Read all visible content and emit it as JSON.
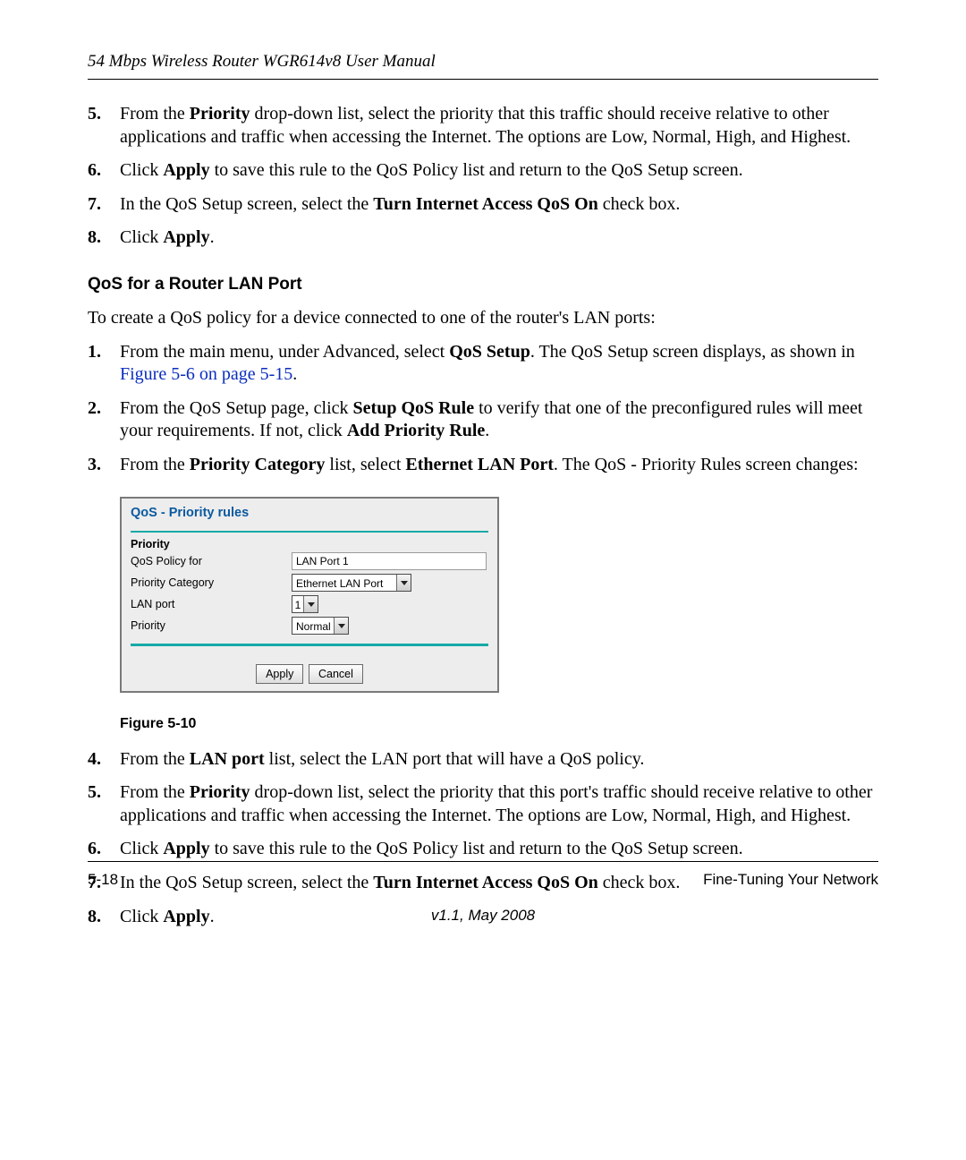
{
  "header": {
    "title": "54 Mbps Wireless Router WGR614v8 User Manual"
  },
  "section_a": {
    "items": [
      {
        "num": "5.",
        "prefix": "From the ",
        "bold1": "Priority",
        "rest": " drop-down list, select the priority that this traffic should receive relative to other applications and traffic when accessing the Internet. The options are Low, Normal, High, and Highest."
      },
      {
        "num": "6.",
        "prefix": "Click ",
        "bold1": "Apply",
        "rest": " to save this rule to the QoS Policy list and return to the QoS Setup screen."
      },
      {
        "num": "7.",
        "prefix": "In the QoS Setup screen, select the ",
        "bold1": "Turn Internet Access QoS On",
        "rest": " check box."
      },
      {
        "num": "8.",
        "prefix": "Click ",
        "bold1": "Apply",
        "rest": "."
      }
    ]
  },
  "heading1": "QoS for a Router LAN Port",
  "intro": "To create a QoS policy for a device connected to one of the router's LAN ports:",
  "section_b": {
    "item1": {
      "num": "1.",
      "t1": "From the main menu, under Advanced, select ",
      "b1": "QoS Setup",
      "t2": ". The QoS Setup screen displays, as shown in ",
      "link": "Figure 5-6 on page 5-15",
      "t3": "."
    },
    "item2": {
      "num": "2.",
      "t1": "From the QoS Setup page, click ",
      "b1": "Setup QoS Rule",
      "t2": " to verify that one of the preconfigured rules will meet your requirements. If not, click ",
      "b2": "Add Priority Rule",
      "t3": "."
    },
    "item3": {
      "num": "3.",
      "t1": "From the ",
      "b1": "Priority Category",
      "t2": " list, select ",
      "b2": "Ethernet LAN Port",
      "t3": ". The QoS - Priority Rules screen changes:"
    }
  },
  "figure": {
    "panel_title": "QoS - Priority rules",
    "subtitle": "Priority",
    "rows": {
      "policy_label": "QoS Policy for",
      "policy_value": "LAN Port 1",
      "category_label": "Priority Category",
      "category_value": "Ethernet LAN Port",
      "lanport_label": "LAN port",
      "lanport_value": "1",
      "priority_label": "Priority",
      "priority_value": "Normal"
    },
    "buttons": {
      "apply": "Apply",
      "cancel": "Cancel"
    },
    "caption": "Figure 5-10"
  },
  "section_c": {
    "item4": {
      "num": "4.",
      "t1": "From the ",
      "b1": "LAN port",
      "t2": " list, select the LAN port that will have a QoS policy."
    },
    "item5": {
      "num": "5.",
      "t1": "From the ",
      "b1": "Priority",
      "t2": " drop-down list, select the priority that this port's traffic should receive relative to other applications and traffic when accessing the Internet. The options are Low, Normal, High, and Highest."
    },
    "item6": {
      "num": "6.",
      "t1": "Click ",
      "b1": "Apply",
      "t2": " to save this rule to the QoS Policy list and return to the QoS Setup screen."
    },
    "item7": {
      "num": "7.",
      "t1": "In the QoS Setup screen, select the ",
      "b1": "Turn Internet Access QoS On",
      "t2": " check box."
    },
    "item8": {
      "num": "8.",
      "t1": "Click ",
      "b1": "Apply",
      "t2": "."
    }
  },
  "footer": {
    "left": "5-18",
    "right": "Fine-Tuning Your Network",
    "version": "v1.1, May 2008"
  }
}
